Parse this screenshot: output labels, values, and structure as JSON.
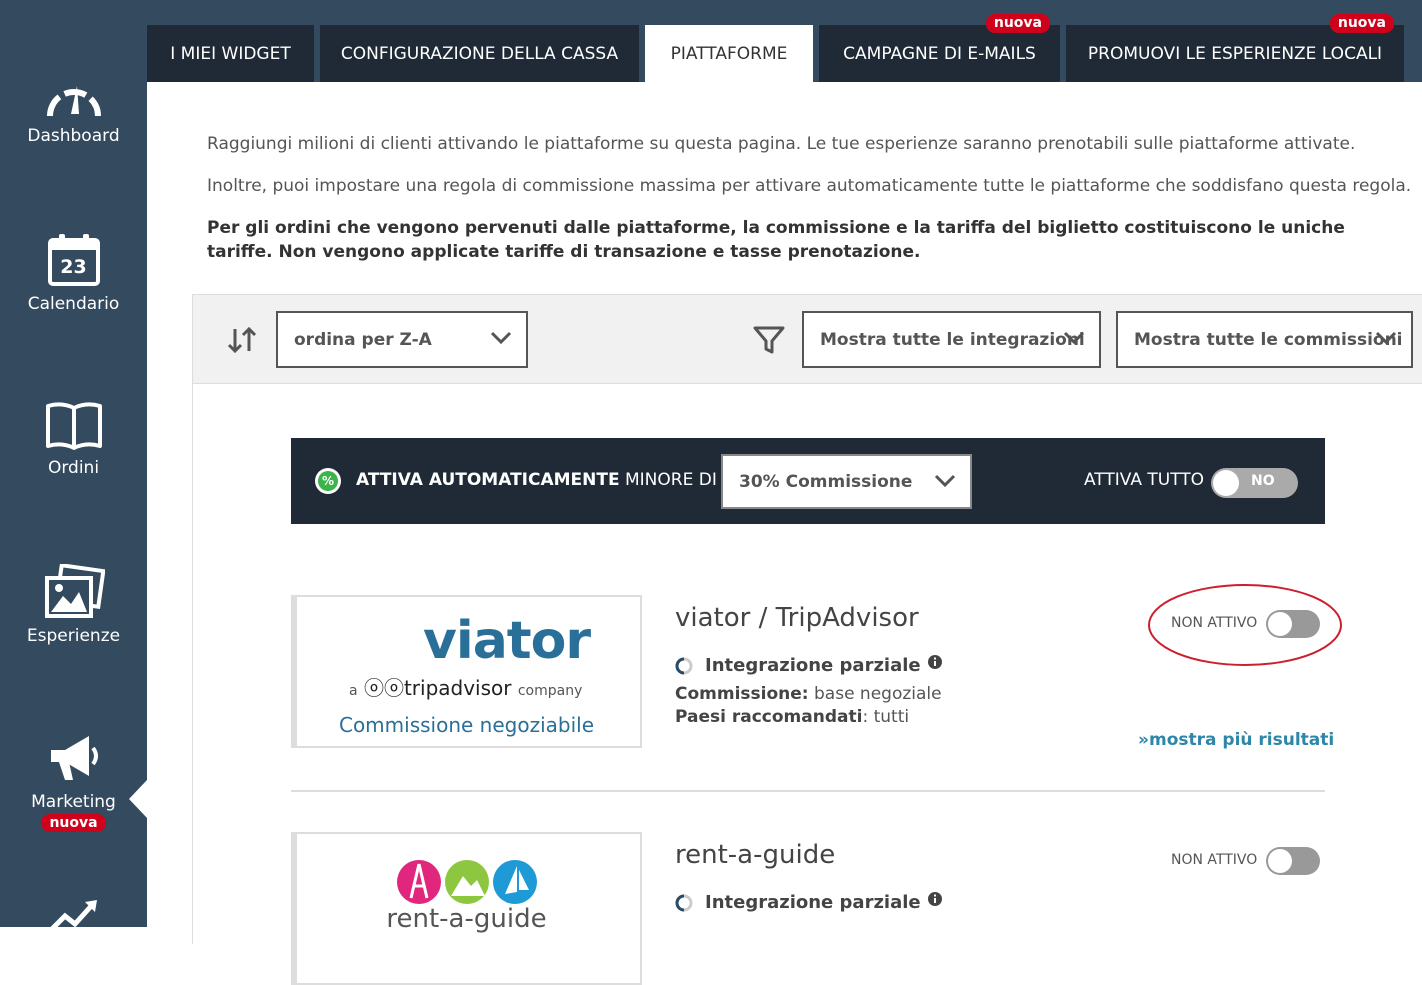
{
  "sidebar": {
    "items": [
      {
        "label": "Dashboard",
        "icon": "gauge-icon"
      },
      {
        "label": "Calendario",
        "icon": "calendar-icon",
        "day": "23"
      },
      {
        "label": "Ordini",
        "icon": "book-icon"
      },
      {
        "label": "Esperienze",
        "icon": "photos-icon"
      },
      {
        "label": "Marketing",
        "icon": "megaphone-icon",
        "badge": "nuova",
        "active": true
      },
      {
        "label": "",
        "icon": "chart-icon"
      }
    ]
  },
  "tabs": [
    {
      "label": "I MIEI WIDGET"
    },
    {
      "label": "CONFIGURAZIONE DELLA CASSA"
    },
    {
      "label": "PIATTAFORME",
      "active": true
    },
    {
      "label": "CAMPAGNE DI E-MAILS",
      "badge": "nuova"
    },
    {
      "label": "PROMUOVI LE ESPERIENZE LOCALI",
      "badge": "nuova"
    }
  ],
  "intro": {
    "p1": "Raggiungi milioni di clienti attivando le piattaforme su questa pagina. Le tue esperienze saranno prenotabili sulle piattaforme attivate.",
    "p2": "Inoltre, puoi impostare una regola di commissione massima per attivare automaticamente tutte le piattaforme che soddisfano questa regola.",
    "p3": "Per gli ordini che vengono pervenuti dalle piattaforme, la commissione e la tariffa del biglietto costituiscono le uniche tariffe. Non vengono applicate tariffe di transazione e tasse prenotazione."
  },
  "filters": {
    "sort": "ordina per Z-A",
    "integrations": "Mostra tutte le integrazioni",
    "commissions": "Mostra tutte le commissioni"
  },
  "autoactivate": {
    "pct_symbol": "%",
    "label_bold": "ATTIVA AUTOMATICAMENTE",
    "label_rest": "MINORE DI",
    "select": "30% Commissione",
    "all_label": "ATTIVA TUTTO",
    "toggle_text": "NO"
  },
  "platforms": [
    {
      "name": "viator / TripAdvisor",
      "logo_main": "viator",
      "logo_a": "a",
      "logo_brand": "tripadvisor",
      "logo_company": "company",
      "logo_caption": "Commissione negoziabile",
      "integration": "Integrazione parziale",
      "commission_label": "Commissione:",
      "commission_value": "base negoziale",
      "countries_label": "Paesi raccomandati",
      "countries_value": ": tutti",
      "status": "NON ATTIVO",
      "more": "»mostra più risultati"
    },
    {
      "name": "rent-a-guide",
      "logo_text": "rent-a-guide",
      "integration": "Integrazione parziale",
      "status": "NON ATTIVO"
    }
  ],
  "colors": {
    "sidebar": "#344a5e",
    "tab_dark": "#1f2a36",
    "badge": "#d0021b",
    "link": "#2e86a8",
    "viator_blue": "#2a6f97",
    "annotation": "#cc1f2e"
  }
}
